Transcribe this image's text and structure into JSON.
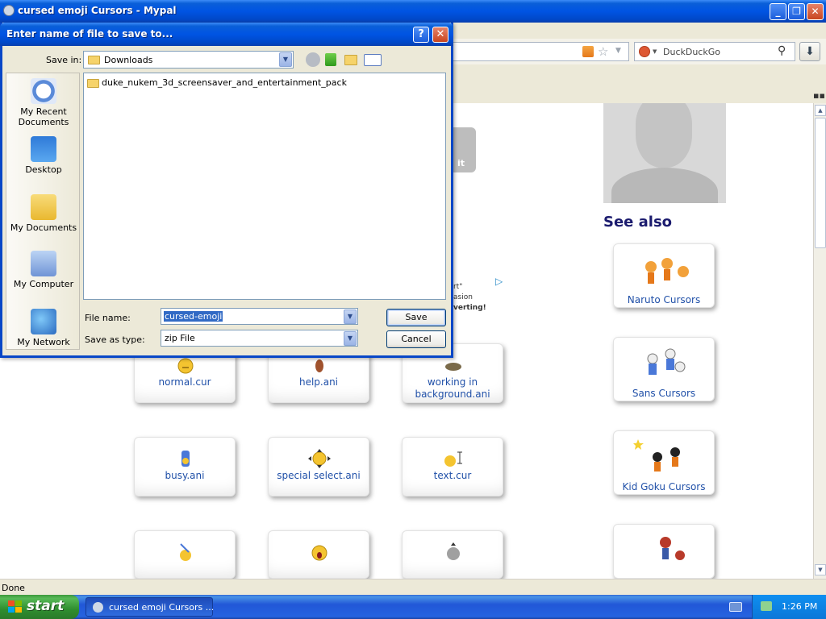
{
  "window": {
    "title": "cursed emoji Cursors - Mypal"
  },
  "toolbar": {
    "search_engine": "DuckDuckGo"
  },
  "page": {
    "partial_button_text": "it",
    "see_also_title": "See also",
    "ad_lines": [
      "rt\"",
      "asion",
      "verting!"
    ],
    "cursors": [
      {
        "label": "normal.cur"
      },
      {
        "label": "help.ani"
      },
      {
        "label": "working in background.ani"
      },
      {
        "label": "busy.ani"
      },
      {
        "label": "special select.ani"
      },
      {
        "label": "text.cur"
      }
    ],
    "see_also": [
      {
        "label": "Naruto Cursors"
      },
      {
        "label": "Sans Cursors"
      },
      {
        "label": "Kid Goku Cursors"
      }
    ]
  },
  "status": {
    "text": "Done"
  },
  "dialog": {
    "title": "Enter name of file to save to...",
    "help_label": "?",
    "close_label": "✕",
    "save_in_label": "Save in:",
    "save_in_value": "Downloads",
    "places": [
      {
        "label": "My Recent Documents"
      },
      {
        "label": "Desktop"
      },
      {
        "label": "My Documents"
      },
      {
        "label": "My Computer"
      },
      {
        "label": "My Network"
      }
    ],
    "files": [
      {
        "name": "duke_nukem_3d_screensaver_and_entertainment_pack"
      }
    ],
    "file_name_label": "File name:",
    "file_name_value": "cursed-emoji",
    "save_as_type_label": "Save as type:",
    "save_as_type_value": "zip File",
    "save_button": "Save",
    "cancel_button": "Cancel"
  },
  "taskbar": {
    "start_label": "start",
    "task_item": "cursed emoji Cursors ...",
    "clock": "1:26 PM"
  }
}
